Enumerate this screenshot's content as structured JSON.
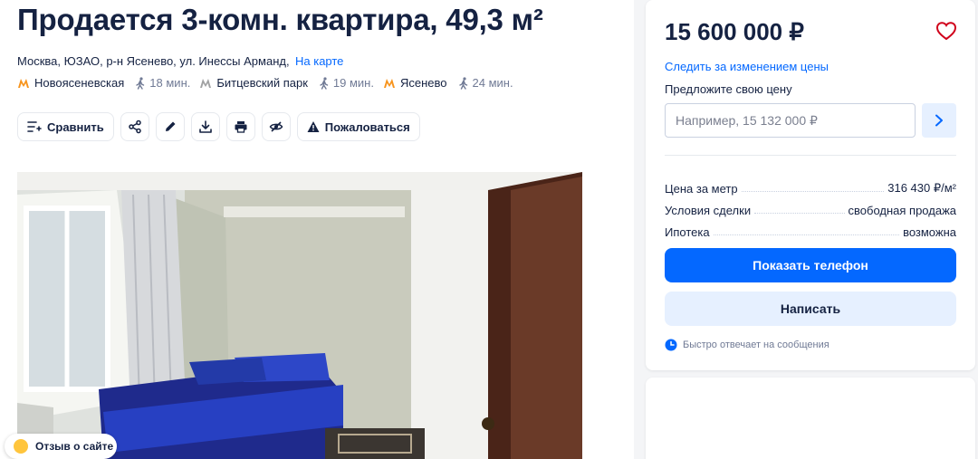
{
  "listing": {
    "title": "Продается 3-комн. квартира, 49,3 м²",
    "address": "Москва, ЮЗАО, р-н Ясенево, ул. Инессы Арманд,",
    "map_link": "На карте",
    "metro": [
      {
        "name": "Новоясеневская",
        "time": "18 мин.",
        "color": "#f7941d",
        "icon": "metro-icon"
      },
      {
        "name": "Битцевский парк",
        "time": "19 мин.",
        "color": "#a1a2a3",
        "icon": "metro-icon"
      },
      {
        "name": "Ясенево",
        "time": "24 мин.",
        "color": "#f7941d",
        "icon": "metro-icon"
      }
    ]
  },
  "toolbar": {
    "compare_label": "Сравнить",
    "report_label": "Пожаловаться"
  },
  "feedback": {
    "label": "Отзыв о сайте"
  },
  "sidebar": {
    "price": "15 600 000 ₽",
    "follow_price": "Следить за изменением цены",
    "offer_label": "Предложите свою цену",
    "offer_placeholder": "Например, 15 132 000 ₽",
    "facts": [
      {
        "key": "Цена за метр",
        "value": "316 430 ₽/м²"
      },
      {
        "key": "Условия сделки",
        "value": "свободная продажа"
      },
      {
        "key": "Ипотека",
        "value": "возможна"
      }
    ],
    "show_phone": "Показать телефон",
    "write": "Написать",
    "fast_reply": "Быстро отвечает на сообщения"
  },
  "colors": {
    "accent": "#0468ff",
    "accent_light": "#e6f0ff",
    "text": "#152242",
    "muted": "#707a95",
    "favorite": "#d0021b"
  }
}
